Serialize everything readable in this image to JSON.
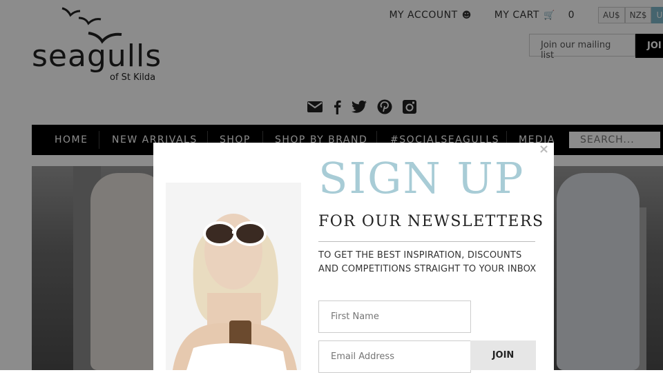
{
  "logo": {
    "word": "seagulls",
    "sub": "of St Kilda"
  },
  "topnav": {
    "account": "MY ACCOUNT",
    "cart": "MY CART",
    "cart_count": "0"
  },
  "currency": [
    "AU$",
    "NZ$",
    "U"
  ],
  "mailing": {
    "placeholder": "Join our mailing list",
    "join": "JOI"
  },
  "social": [
    "email-icon",
    "facebook-icon",
    "twitter-icon",
    "pinterest-icon",
    "instagram-icon"
  ],
  "nav": {
    "items": [
      "HOME",
      "NEW ARRIVALS",
      "SHOP",
      "SHOP BY BRAND",
      "#SOCIALSEAGULLS",
      "MEDIA"
    ],
    "search_placeholder": "SEARCH..."
  },
  "modal": {
    "title": "SIGN UP",
    "subtitle": "FOR OUR NEWSLETTERS",
    "description": "TO GET THE BEST INSPIRATION, DISCOUNTS AND COMPETITIONS STRAIGHT TO YOUR INBOX",
    "first_name_placeholder": "First Name",
    "email_placeholder": "Email Address",
    "join": "JOIN",
    "close": "×"
  },
  "colors": {
    "accent": "#a8ccd6",
    "nav_bg": "#000000",
    "overlay": "rgba(0,0,0,0.45)"
  }
}
